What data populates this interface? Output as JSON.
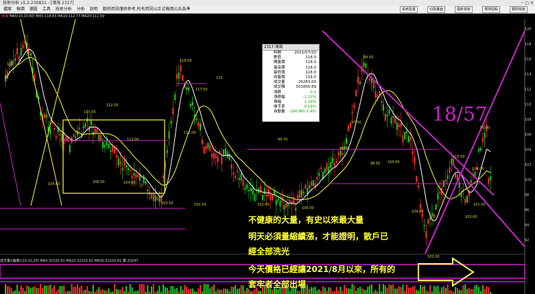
{
  "app": {
    "title": "技術分析 v5.2.230831 - [鴻海 2317]",
    "window_controls": "─ □ ✕"
  },
  "menu": {
    "items": [
      "檔案",
      "報價",
      "選股",
      "工具",
      "技術分析",
      "分析",
      "說明",
      "範例資訊僅供參考,所有資訊以正式報價公告為準"
    ],
    "right_buttons": [
      "系統設置",
      "切換畫面",
      "開新視窗",
      "選擇個股",
      "關閉視窗"
    ]
  },
  "chart_header": {
    "symbol": "鴻海",
    "ma_text": "MA5(10,20,60) MA5:118.83 MA10:112.77 MA20:111.59"
  },
  "infobox": {
    "title": "2317-鴻海",
    "rows": [
      {
        "k": "時間",
        "v": "2021/07/20"
      },
      {
        "k": "數值",
        "v": "118.0"
      },
      {
        "k": "開盤價",
        "v": "118.0"
      },
      {
        "k": "最高價",
        "v": "118.0"
      },
      {
        "k": "最低價",
        "v": "118.0"
      },
      {
        "k": "收盤價",
        "v": "118.0"
      },
      {
        "k": "成交量",
        "v": "26283.00"
      },
      {
        "k": "成交額",
        "v": "301856.89"
      },
      {
        "k": "漲跌",
        "v": "-0.1"
      },
      {
        "k": "漲跌幅",
        "v": "-1.12%"
      },
      {
        "k": "振幅",
        "v": "1.29%"
      },
      {
        "k": "換手率",
        "v": "0.19%"
      },
      {
        "k": "自動量",
        "v": "-290.86(-1.40)"
      }
    ]
  },
  "annotations": {
    "line1": "不健康的大量，有史以來最大量",
    "line2": "明天必須量縮續漲，才能證明，散戶已",
    "line3": "經全部洗光",
    "line4": "今天價格已經讓2021/8月以來，所有的",
    "line5": "套牢者全部出場",
    "ratio": "18/57"
  },
  "volume_header": {
    "text": "成交量/(縮量)(10,10,20)  MA5:32102.61 MA10:32102.61 MA20:32102.61 量:20247"
  },
  "right_axis": [
    "120",
    "118",
    "116",
    "114",
    "112",
    "110",
    "108",
    "106",
    "104",
    "102",
    "100",
    "98",
    "96",
    "94",
    "92"
  ],
  "price_labels": [
    "115",
    "118.00",
    "117.50",
    "115",
    "112.00",
    "113.50",
    "112.00",
    "110.00",
    "106.50",
    "105.00",
    "104.00",
    "103.50",
    "102.50",
    "102.00",
    "100.00",
    "99.70",
    "99.50",
    "98.50",
    "97.50",
    "96.50",
    "115.50",
    "104.00",
    "103.00",
    "102.00",
    "105.00",
    "104.00",
    "101.50",
    "95.00"
  ],
  "colors": {
    "up": "#ff3030",
    "down": "#22cc22",
    "ma_yellow": "#ffff33",
    "ma_white": "#ffffff",
    "trend_magenta": "#cc22cc",
    "box_yellow": "#ffff33",
    "annotation_yellow": "#ffff33"
  }
}
